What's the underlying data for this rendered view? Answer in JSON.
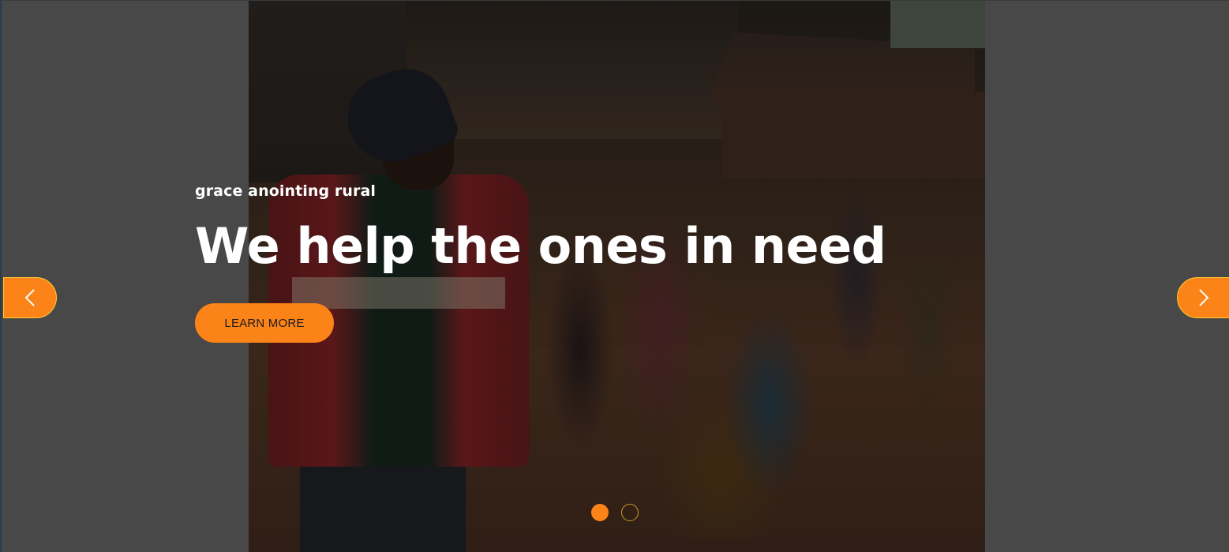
{
  "slider": {
    "subtitle": "grace anointing rural",
    "headline": "We help the ones in need",
    "cta_label": "LEARN MORE",
    "prev_icon": "chevron-left-icon",
    "next_icon": "chevron-right-icon",
    "active_slide": 1,
    "slide_count": 2,
    "colors": {
      "accent": "#fc8318",
      "accent_border": "#ffcc33",
      "background": "#484848",
      "text": "#ffffff"
    }
  }
}
